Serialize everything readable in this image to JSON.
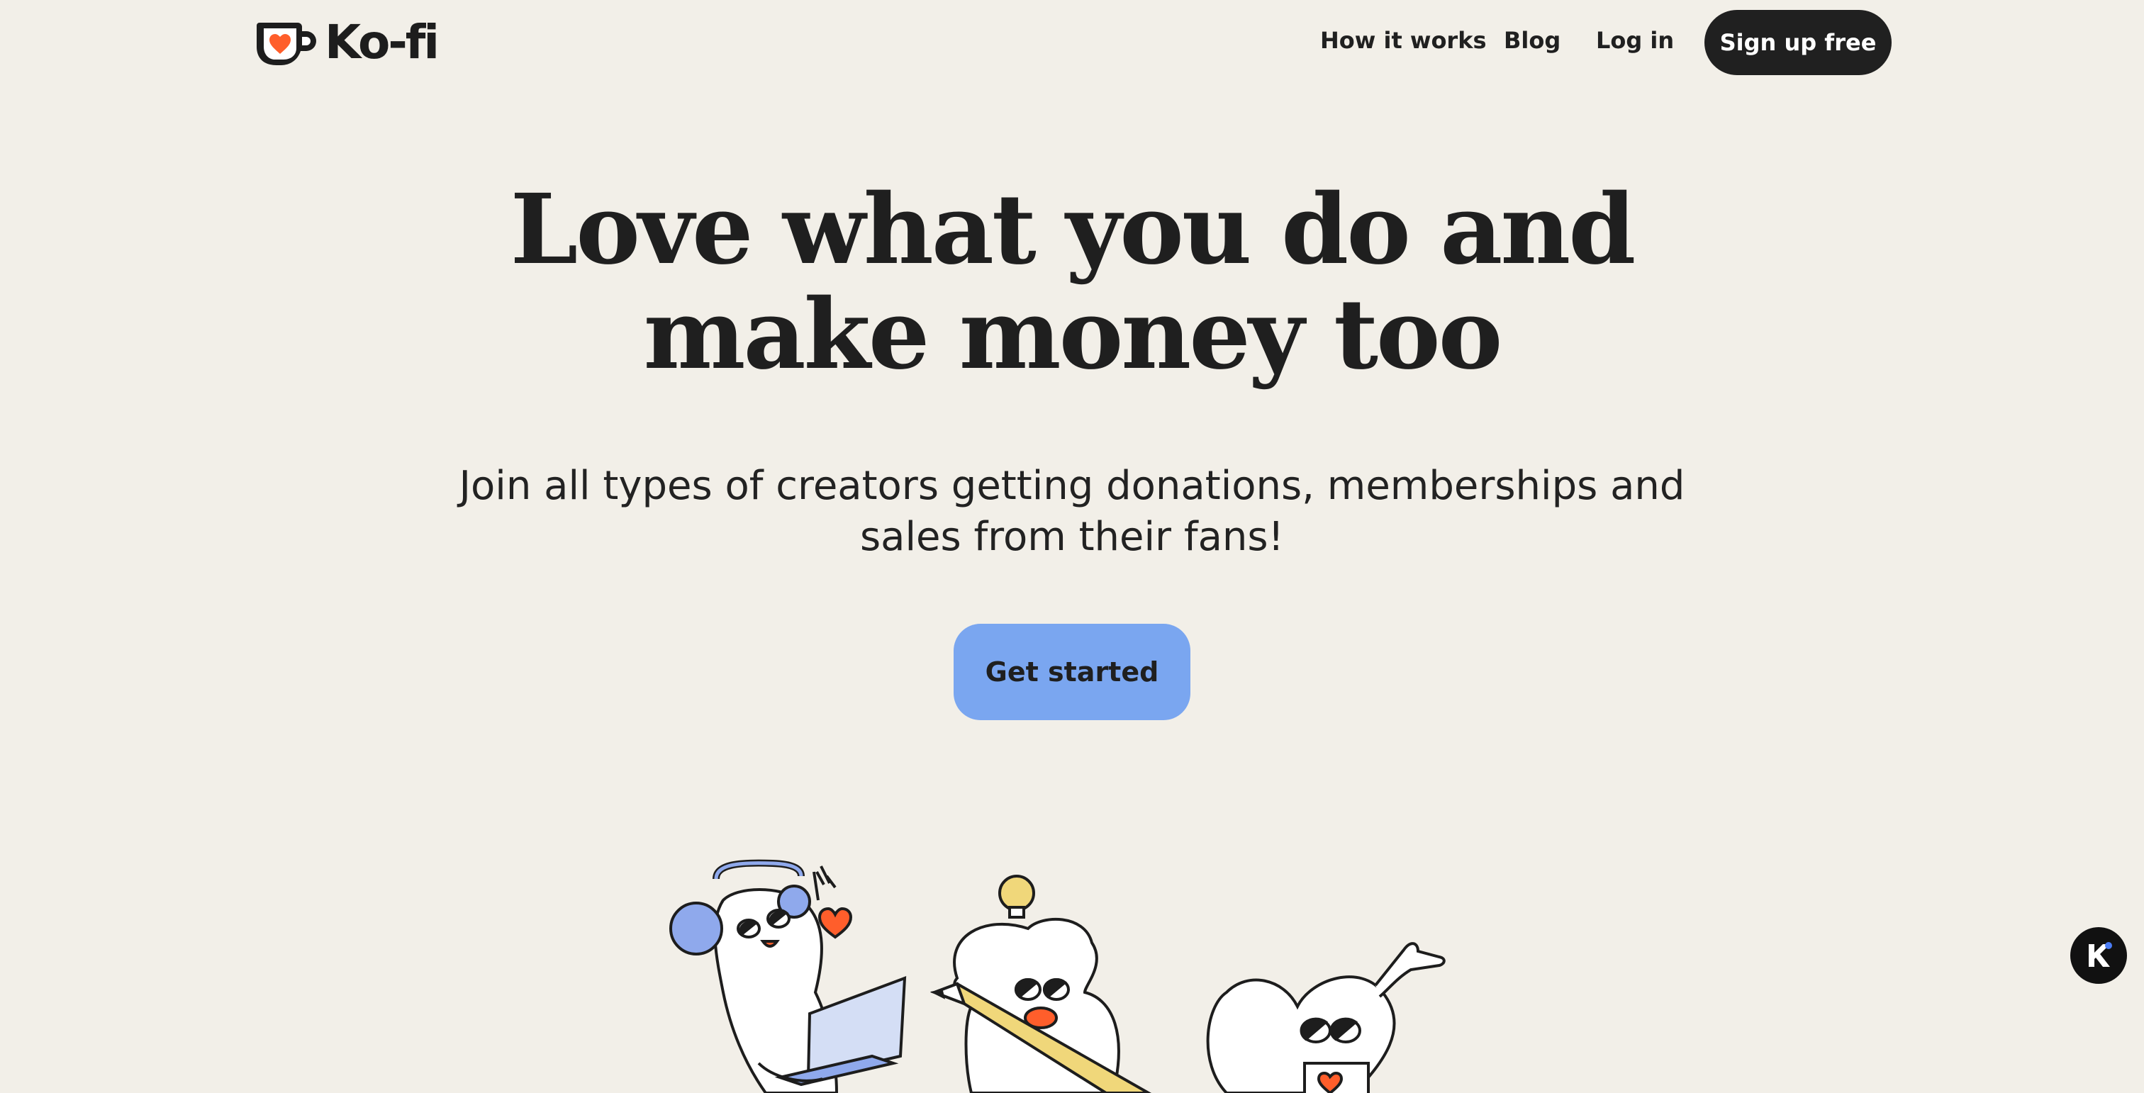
{
  "header": {
    "logo_text": "Ko-fi",
    "nav": [
      {
        "label": "How it works"
      },
      {
        "label": "Blog"
      },
      {
        "label": "Log in"
      }
    ],
    "signup_label": "Sign up free"
  },
  "hero": {
    "headline_line1": "Love what you do and",
    "headline_line2": "make money too",
    "subhead_line1": "Join all types of creators getting donations, memberships and",
    "subhead_line2": "sales from their fans!",
    "cta_label": "Get started"
  },
  "badge": {
    "icon": "kofi-k-icon"
  },
  "colors": {
    "background": "#f2efe8",
    "text": "#202020",
    "cta": "#7aa6f0",
    "accent_heart": "#ff5e2b",
    "character_blue": "#8fa9ec",
    "pencil_yellow": "#f0d77a"
  }
}
